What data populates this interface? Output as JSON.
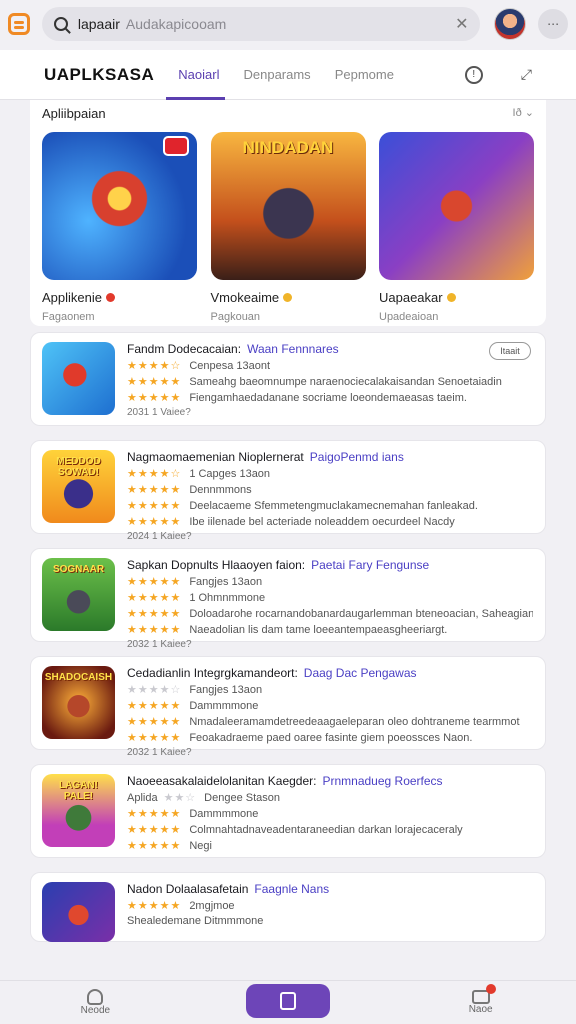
{
  "search": {
    "query": "lapaair",
    "placeholder": "Audakapicooam",
    "clear_icon": "close-x-icon"
  },
  "header": {
    "brand": "UAPLKSASA",
    "tabs": [
      {
        "label": "Naoiarl",
        "active": true
      },
      {
        "label": "Denparams",
        "active": false
      },
      {
        "label": "Pepmome",
        "active": false
      }
    ],
    "info_icon": "!",
    "share_icon": "⤢"
  },
  "featured": {
    "title": "Apliibpaian",
    "more_label": "Ið ⌄",
    "items": [
      {
        "name": "Applikenie",
        "sub": "Fagaonem",
        "dot_color": "#e23a2c"
      },
      {
        "name": "Vmokeaime",
        "sub": "Pagkouan",
        "banner": "NINDADAN",
        "dot_color": "#f0b429"
      },
      {
        "name": "Uapaeakar",
        "sub": "Upadeaioan",
        "dot_color": "#f0b429"
      }
    ]
  },
  "games": [
    {
      "title": "Fandm Dodecacaian:",
      "publisher": "Waan Fennnares",
      "rating_text": "Cenpesa 13aont",
      "line2": "Sameahg baeomnumpe naraenociecalakaisandan Senoetaiadin",
      "line3": "Fiengamhaedadanane socriame loeondemaeasas taeim.",
      "footer": "2031 1 Vaiee?",
      "button": "Itaait"
    },
    {
      "title": "Nagmaomaemenian Nioplernerat",
      "publisher": "PaigoPenmd ians",
      "rating_text": "1 Capges 13aon",
      "line2": "Dennmmons",
      "line3": "Deelacaeme Sfemmetengmuclakamecnemahan fanleakad.",
      "line4": "Ibe iilenade bel acteriade noleaddem oecurdeel Nacdy",
      "footer": "2024 1 Kaiee?",
      "icon_text": "MEDDOD SOWAD!"
    },
    {
      "title": "Sapkan Dopnults Hlaaoyen faion:",
      "publisher": "Paetai Fary Fengunse",
      "rating_text": "Fangjes 13aon",
      "line2": "1 Ohmnmmone",
      "line3": "Doloadarohe rocarnandobanardaugarlemman bteneoacian, Saheagiang",
      "line4": "Naeadolian lis dam tame loeeantempaeasgheeriargt.",
      "footer": "2032 1 Kaiee?",
      "icon_text": "SOGNAAR"
    },
    {
      "title": "Cedadianlin Integrgkamandeort:",
      "publisher": "Daag Dac Pengawas",
      "rating_text": "Fangjes 13aon",
      "line2": "Dammmmone",
      "line3": "Nmadaleeramamdetreedeaagaeleparan oleo dohtraneme tearmmot",
      "line4": "Feoakadraeme paed oaree fasinte giem poeossces Naon.",
      "footer": "2032 1 Kaiee?",
      "icon_text": "SHADOCAISH"
    },
    {
      "title": "Naoeeasakalaidelolanitan Kaegder:",
      "publisher": "Prnmnadueg Roerfecs",
      "line_a": "Aplida",
      "rating_text": "Dengee Stason",
      "line2": "Dammmmone",
      "line3": "Colmnahtadnaveadentaraneedian darkan lorajecaceraly",
      "line4": "Negi",
      "icon_text": "LAGAN! PALE!"
    },
    {
      "title": "Nadon Dolaalasafetain",
      "publisher": "Faagnle Nans",
      "rating_text": "2mgjmoe",
      "line2": "Shealedemane Ditmmmone"
    }
  ],
  "bottom_nav": {
    "left": "Neode",
    "right": "Naoe"
  }
}
